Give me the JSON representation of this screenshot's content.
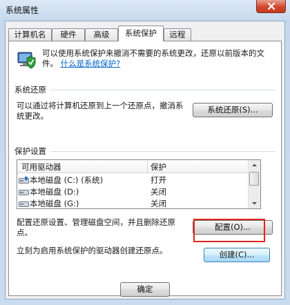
{
  "window": {
    "title": "系统属性"
  },
  "tabs": [
    {
      "label": "计算机名"
    },
    {
      "label": "硬件"
    },
    {
      "label": "高级"
    },
    {
      "label": "系统保护"
    },
    {
      "label": "远程"
    }
  ],
  "intro": {
    "text": "可以使用系统保护来撤消不需要的系统更改，还原以前版本的文件。",
    "link": "什么是系统保护?"
  },
  "restore": {
    "group_title": "系统还原",
    "description": "可以通过将计算机还原到上一个还原点，撤消系统更改。",
    "button": "系统还原(S)..."
  },
  "protection": {
    "group_title": "保护设置",
    "columns": [
      "可用驱动器",
      "保护"
    ],
    "rows": [
      {
        "drive": "本地磁盘 (C:) (系统)",
        "protection": "打开"
      },
      {
        "drive": "本地磁盘 (D:)",
        "protection": "关闭"
      },
      {
        "drive": "本地磁盘 (G:)",
        "protection": "关闭"
      }
    ],
    "configure_text": "配置还原设置、管理磁盘空间，并且删除还原点。",
    "configure_button": "配置(O)...",
    "create_text": "立刻为启用系统保护的驱动器创建还原点。",
    "create_button": "创建(C)..."
  },
  "footer": {
    "ok_button": "确定"
  },
  "colors": {
    "accent_link": "#0066cc",
    "highlight_border": "#e2231a",
    "close_button": "#d2472e"
  }
}
